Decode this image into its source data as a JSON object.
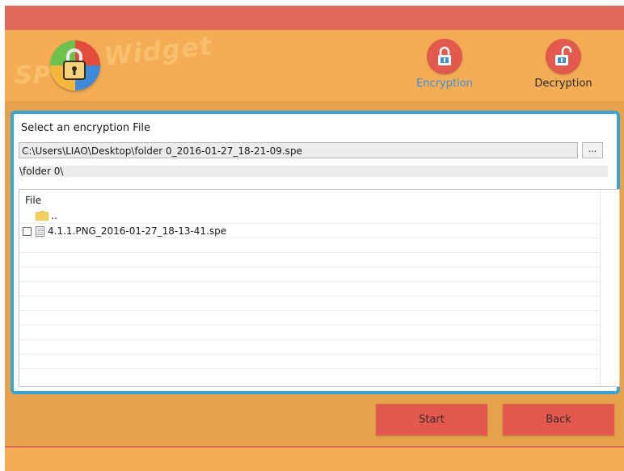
{
  "app": {
    "logo_prefix": "SP",
    "logo_suffix": "Widget"
  },
  "nav": {
    "encryption_label": "Encryption",
    "decryption_label": "Decryption"
  },
  "panel": {
    "select_label": "Select an encryption File",
    "path_value": "C:\\Users\\LIAO\\Desktop\\folder 0_2016-01-27_18-21-09.spe",
    "browse_label": "...",
    "current_folder": "\\folder 0\\"
  },
  "file_list": {
    "header": "File",
    "items": [
      {
        "name": "..",
        "type": "folder"
      },
      {
        "name": "4.1.1.PNG_2016-01-27_18-13-41.spe",
        "type": "file"
      }
    ]
  },
  "actions": {
    "start_label": "Start",
    "back_label": "Back"
  },
  "colors": {
    "header_bg": "#f4ad55",
    "title_bar": "#e06a5a",
    "panel_border": "#36a6d8",
    "button_red": "#e2594e",
    "active_nav_text": "#3f8fd6"
  },
  "icons": {
    "logo": "padlock-logo-icon",
    "encryption": "locked-padlock-icon",
    "decryption": "unlocked-padlock-icon",
    "folder": "folder-icon",
    "file": "document-icon"
  }
}
